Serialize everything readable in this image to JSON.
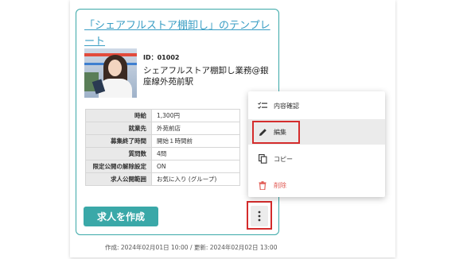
{
  "card": {
    "title": "「シェアフルストア棚卸し」のテンプレート",
    "job_id": "ID：01002",
    "job_name": "シェアフルストア棚卸し業務@銀座線外苑前駅",
    "info_rows": [
      {
        "label": "時給",
        "value": "1,300円"
      },
      {
        "label": "就業先",
        "value": "外苑前店"
      },
      {
        "label": "募集終了時間",
        "value": "開始１時間前"
      },
      {
        "label": "質問数",
        "value": "4問"
      },
      {
        "label": "限定公開の解除設定",
        "value": "ON"
      },
      {
        "label": "求人公開範囲",
        "value": "お気に入り (グループ)"
      }
    ],
    "create_button": "求人を作成",
    "timestamps": "作成: 2024年02月01日 10:00 / 更新: 2024年02月02日 13:00"
  },
  "menu": {
    "items": [
      {
        "label": "内容確認",
        "icon": "checklist-icon"
      },
      {
        "label": "編集",
        "icon": "pencil-icon"
      },
      {
        "label": "コピー",
        "icon": "copy-icon"
      },
      {
        "label": "削除",
        "icon": "trash-icon"
      }
    ]
  },
  "colors": {
    "accent": "#3aa8a8",
    "link": "#3a9ec4",
    "danger": "#e0564f",
    "highlight": "#d42c2c"
  }
}
